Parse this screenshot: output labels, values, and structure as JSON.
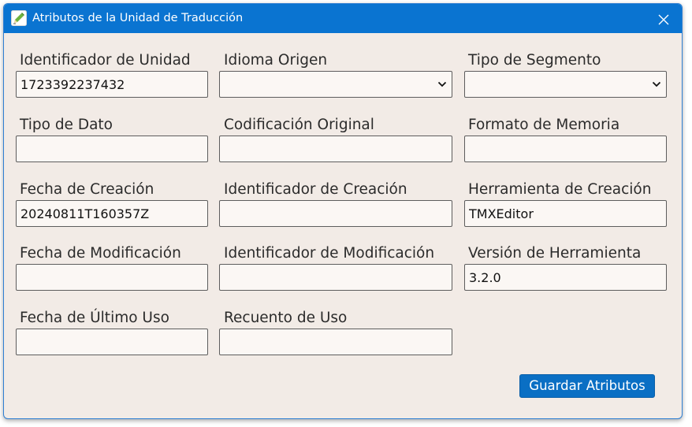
{
  "window": {
    "title": "Atributos de la Unidad de Traducción",
    "icon": "pen-edit-icon",
    "close_icon": "close-icon"
  },
  "form": {
    "unit_id": {
      "label": "Identificador de Unidad",
      "value": "1723392237432"
    },
    "source_lang": {
      "label": "Idioma Origen",
      "value": ""
    },
    "segment_type": {
      "label": "Tipo de Segmento",
      "value": ""
    },
    "data_type": {
      "label": "Tipo de Dato",
      "value": ""
    },
    "original_encoding": {
      "label": "Codificación Original",
      "value": ""
    },
    "memory_format": {
      "label": "Formato de Memoria",
      "value": ""
    },
    "creation_date": {
      "label": "Fecha de Creación",
      "value": "20240811T160357Z"
    },
    "creation_id": {
      "label": "Identificador de Creación",
      "value": ""
    },
    "creation_tool": {
      "label": "Herramienta de Creación",
      "value": "TMXEditor"
    },
    "modification_date": {
      "label": "Fecha de Modificación",
      "value": ""
    },
    "modification_id": {
      "label": "Identificador de Modificación",
      "value": ""
    },
    "tool_version": {
      "label": "Versión de Herramienta",
      "value": "3.2.0"
    },
    "last_usage_date": {
      "label": "Fecha de Último Uso",
      "value": ""
    },
    "usage_count": {
      "label": "Recuento de Uso",
      "value": ""
    }
  },
  "actions": {
    "save_label": "Guardar Atributos"
  },
  "colors": {
    "titlebar": "#0a74d1",
    "background": "#f2ebe6",
    "field_bg": "#fbf7f4",
    "button": "#0a6fc4"
  }
}
